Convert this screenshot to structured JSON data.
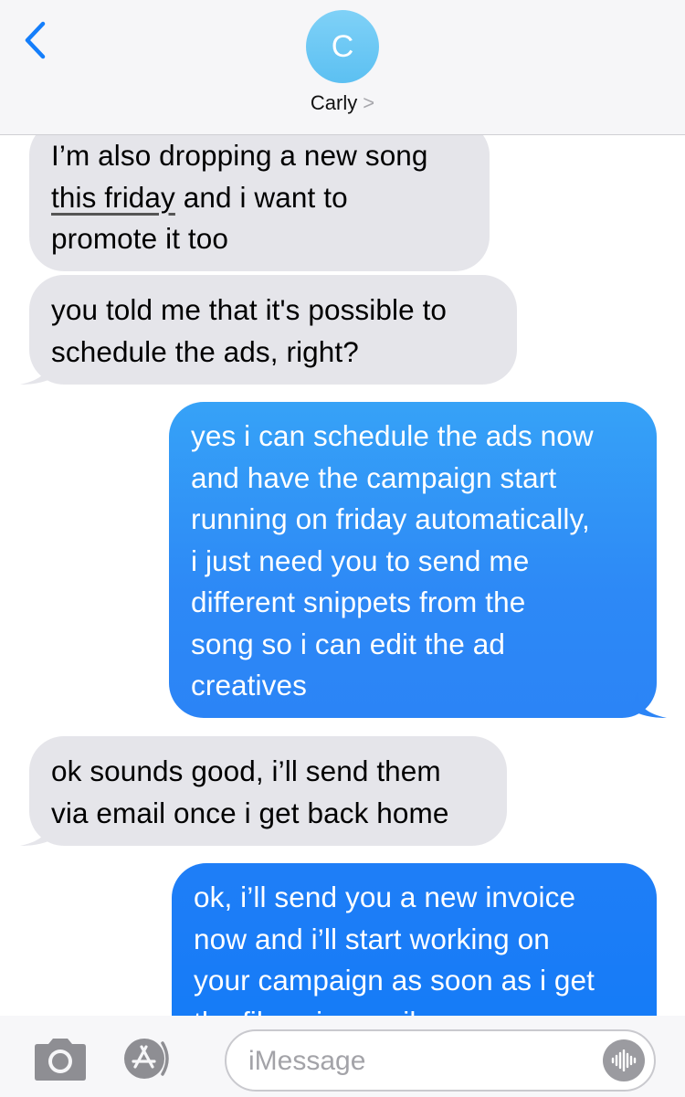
{
  "header": {
    "avatar_initial": "C",
    "contact_name": "Carly",
    "chevron": ">"
  },
  "messages": [
    {
      "from": "contact",
      "parts": [
        "I’m also dropping a new song",
        "this friday",
        "and i want to",
        "promote it too"
      ]
    },
    {
      "from": "contact",
      "lines": [
        "you told me that it's possible to",
        "schedule the ads, right?"
      ]
    },
    {
      "from": "me",
      "lines": [
        "yes i can schedule the ads now",
        "and have the campaign start",
        "running on friday automatically,",
        "i just need you to send me",
        "different snippets from the",
        "song so i can edit the ad",
        "creatives"
      ]
    },
    {
      "from": "contact",
      "lines": [
        "ok sounds good, i’ll send them",
        "via email once i get back home"
      ]
    },
    {
      "from": "me",
      "lines": [
        "ok, i’ll send you a new invoice",
        "now and i’ll start working on",
        "your campaign as soon as i get",
        "the files via email"
      ]
    }
  ],
  "input": {
    "placeholder": "iMessage",
    "value": ""
  },
  "colors": {
    "accent": "#147efb",
    "received_bubble": "#e5e5ea",
    "sent_bubble_top": "#36a2f7",
    "sent_bubble_bottom": "#137bf7",
    "avatar": "#6cc8f5"
  },
  "icons": [
    "chevron-left-icon",
    "camera-icon",
    "app-store-icon",
    "audio-waveform-icon"
  ]
}
